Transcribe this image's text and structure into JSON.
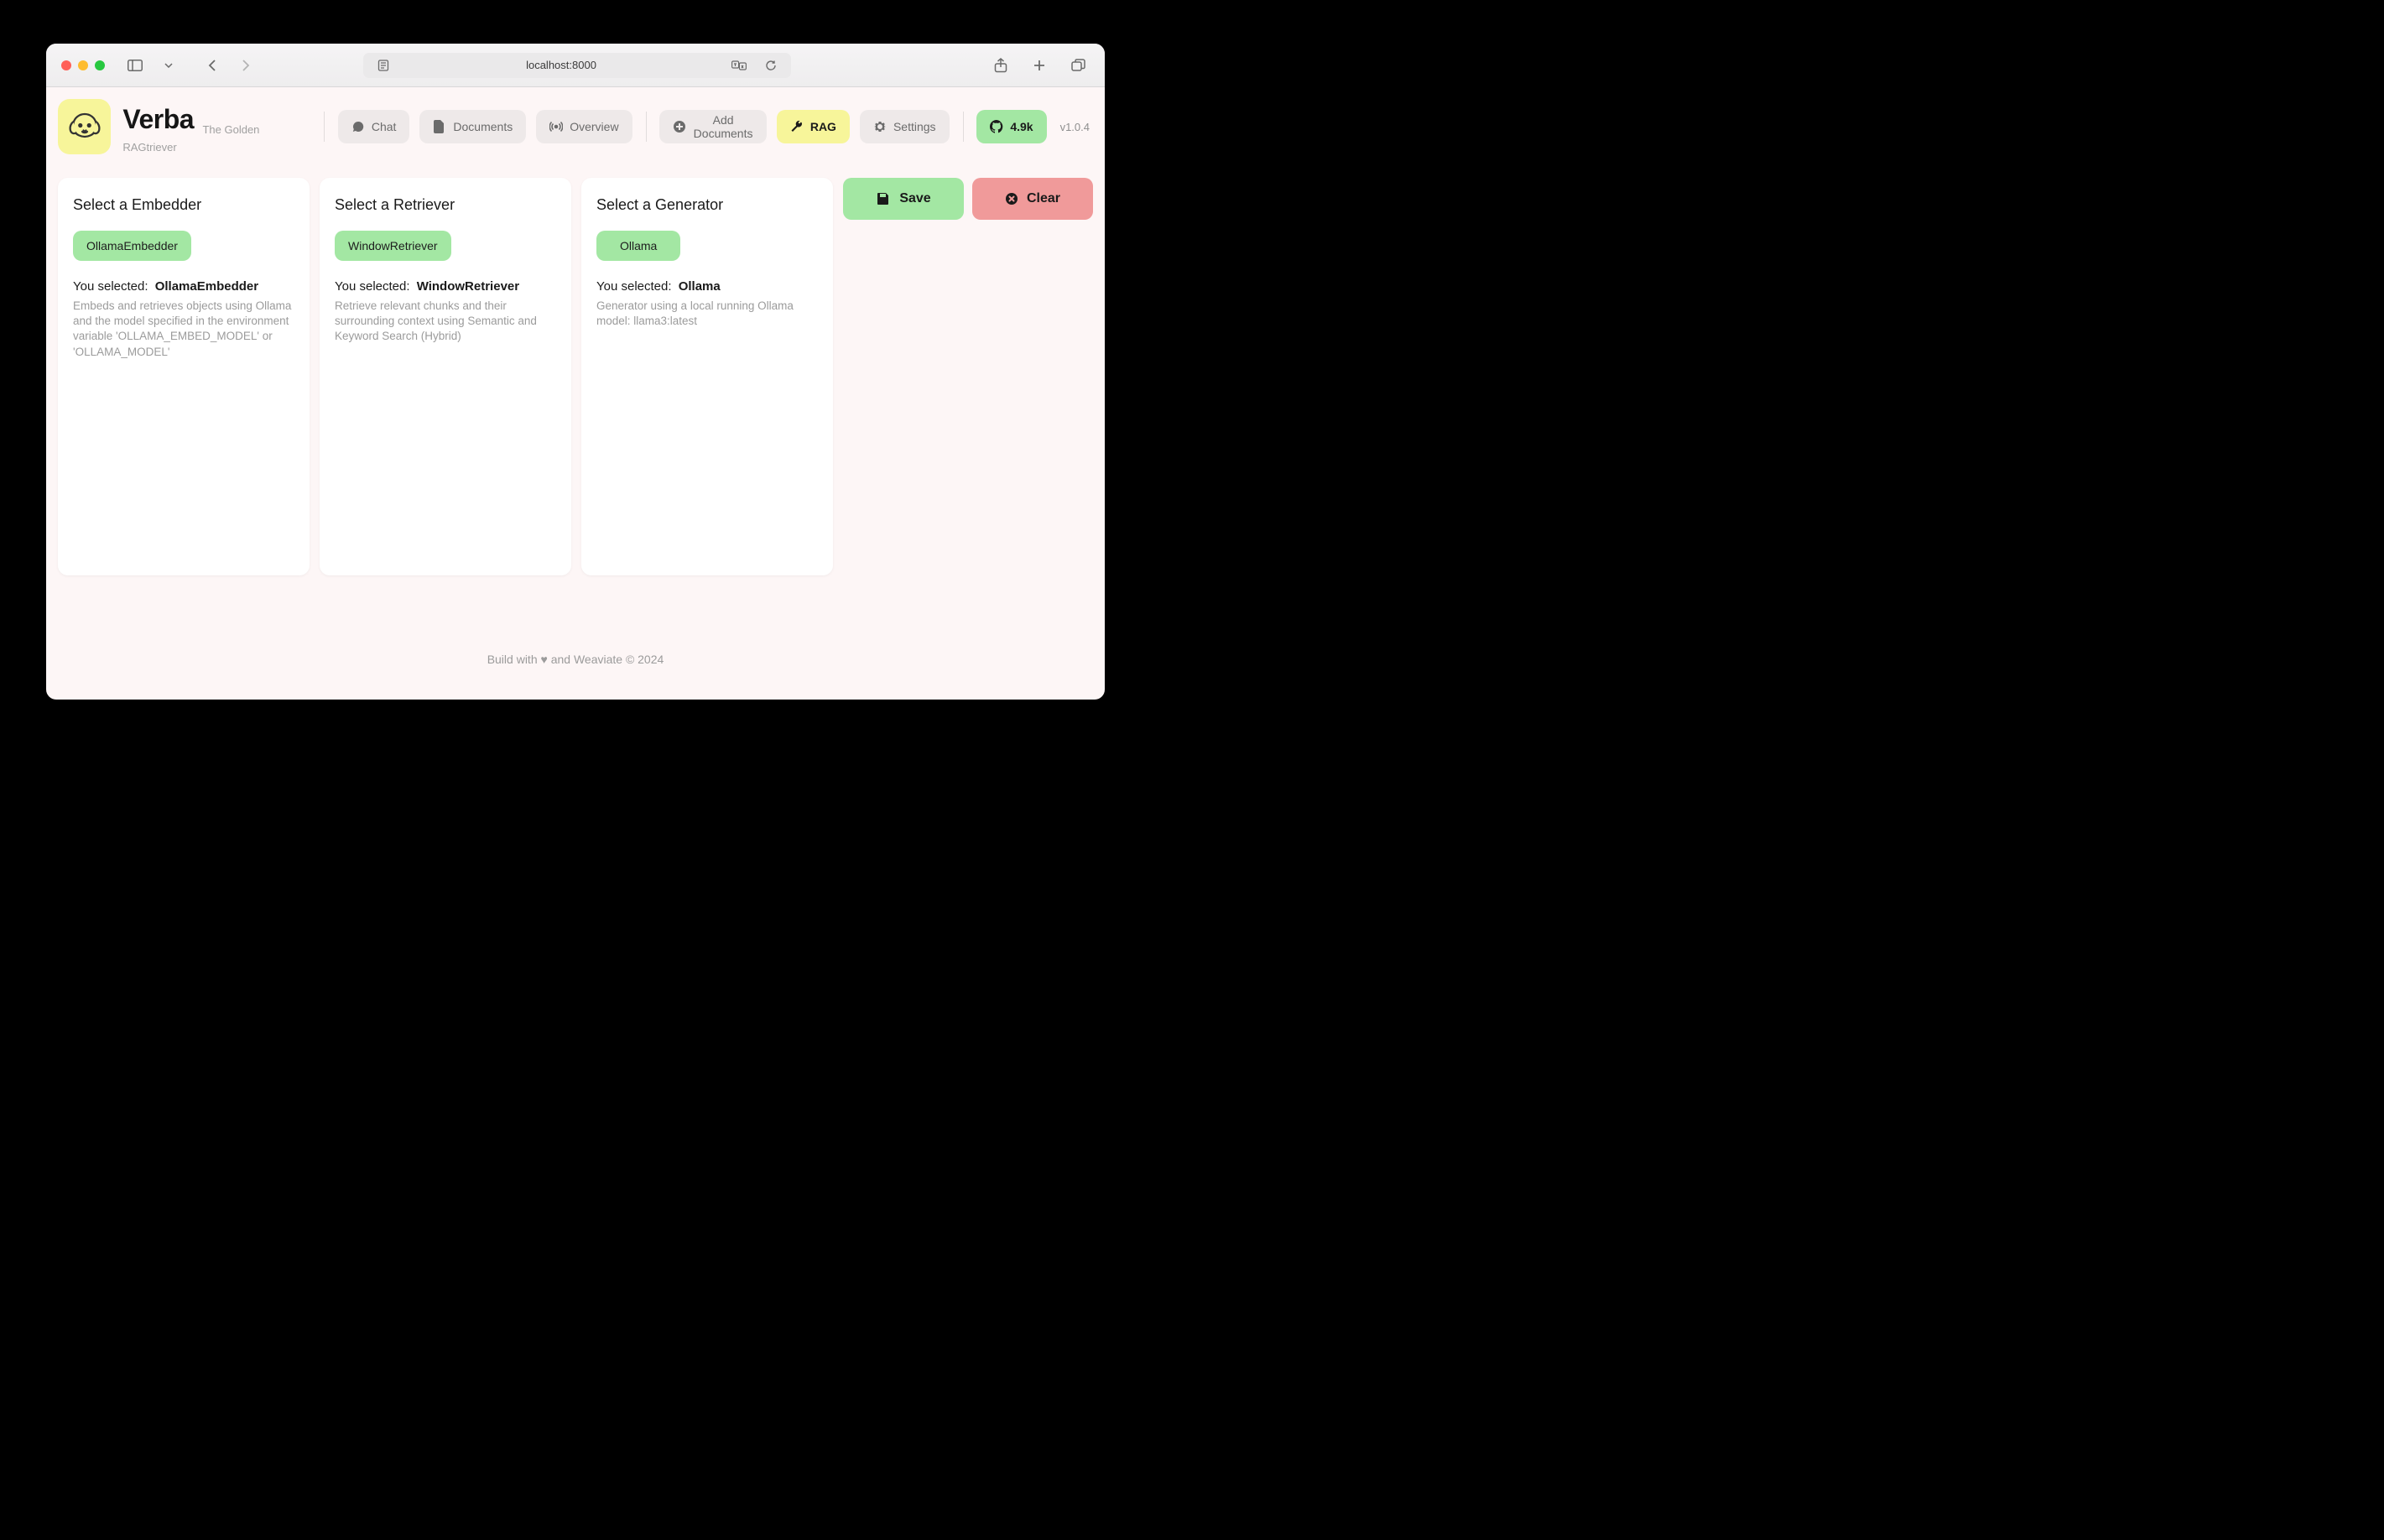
{
  "browser": {
    "url": "localhost:8000"
  },
  "brand": {
    "title": "Verba",
    "subtitle": "The Golden RAGtriever"
  },
  "nav": {
    "chat": "Chat",
    "documents": "Documents",
    "overview": "Overview",
    "add_documents": "Add Documents",
    "rag": "RAG",
    "settings": "Settings",
    "stars": "4.9k",
    "version": "v1.0.4"
  },
  "cards": {
    "embedder": {
      "title": "Select a Embedder",
      "chip": "OllamaEmbedder",
      "selected_label": "You selected:",
      "selected_value": "OllamaEmbedder",
      "desc": "Embeds and retrieves objects using Ollama and the model specified in the environment variable 'OLLAMA_EMBED_MODEL' or 'OLLAMA_MODEL'"
    },
    "retriever": {
      "title": "Select a Retriever",
      "chip": "WindowRetriever",
      "selected_label": "You selected:",
      "selected_value": "WindowRetriever",
      "desc": "Retrieve relevant chunks and their surrounding context using Semantic and Keyword Search (Hybrid)"
    },
    "generator": {
      "title": "Select a Generator",
      "chip": "Ollama",
      "selected_label": "You selected:",
      "selected_value": "Ollama",
      "desc": "Generator using a local running Ollama model: llama3:latest"
    }
  },
  "actions": {
    "save": "Save",
    "clear": "Clear"
  },
  "footer": "Build with ♥ and Weaviate © 2024"
}
